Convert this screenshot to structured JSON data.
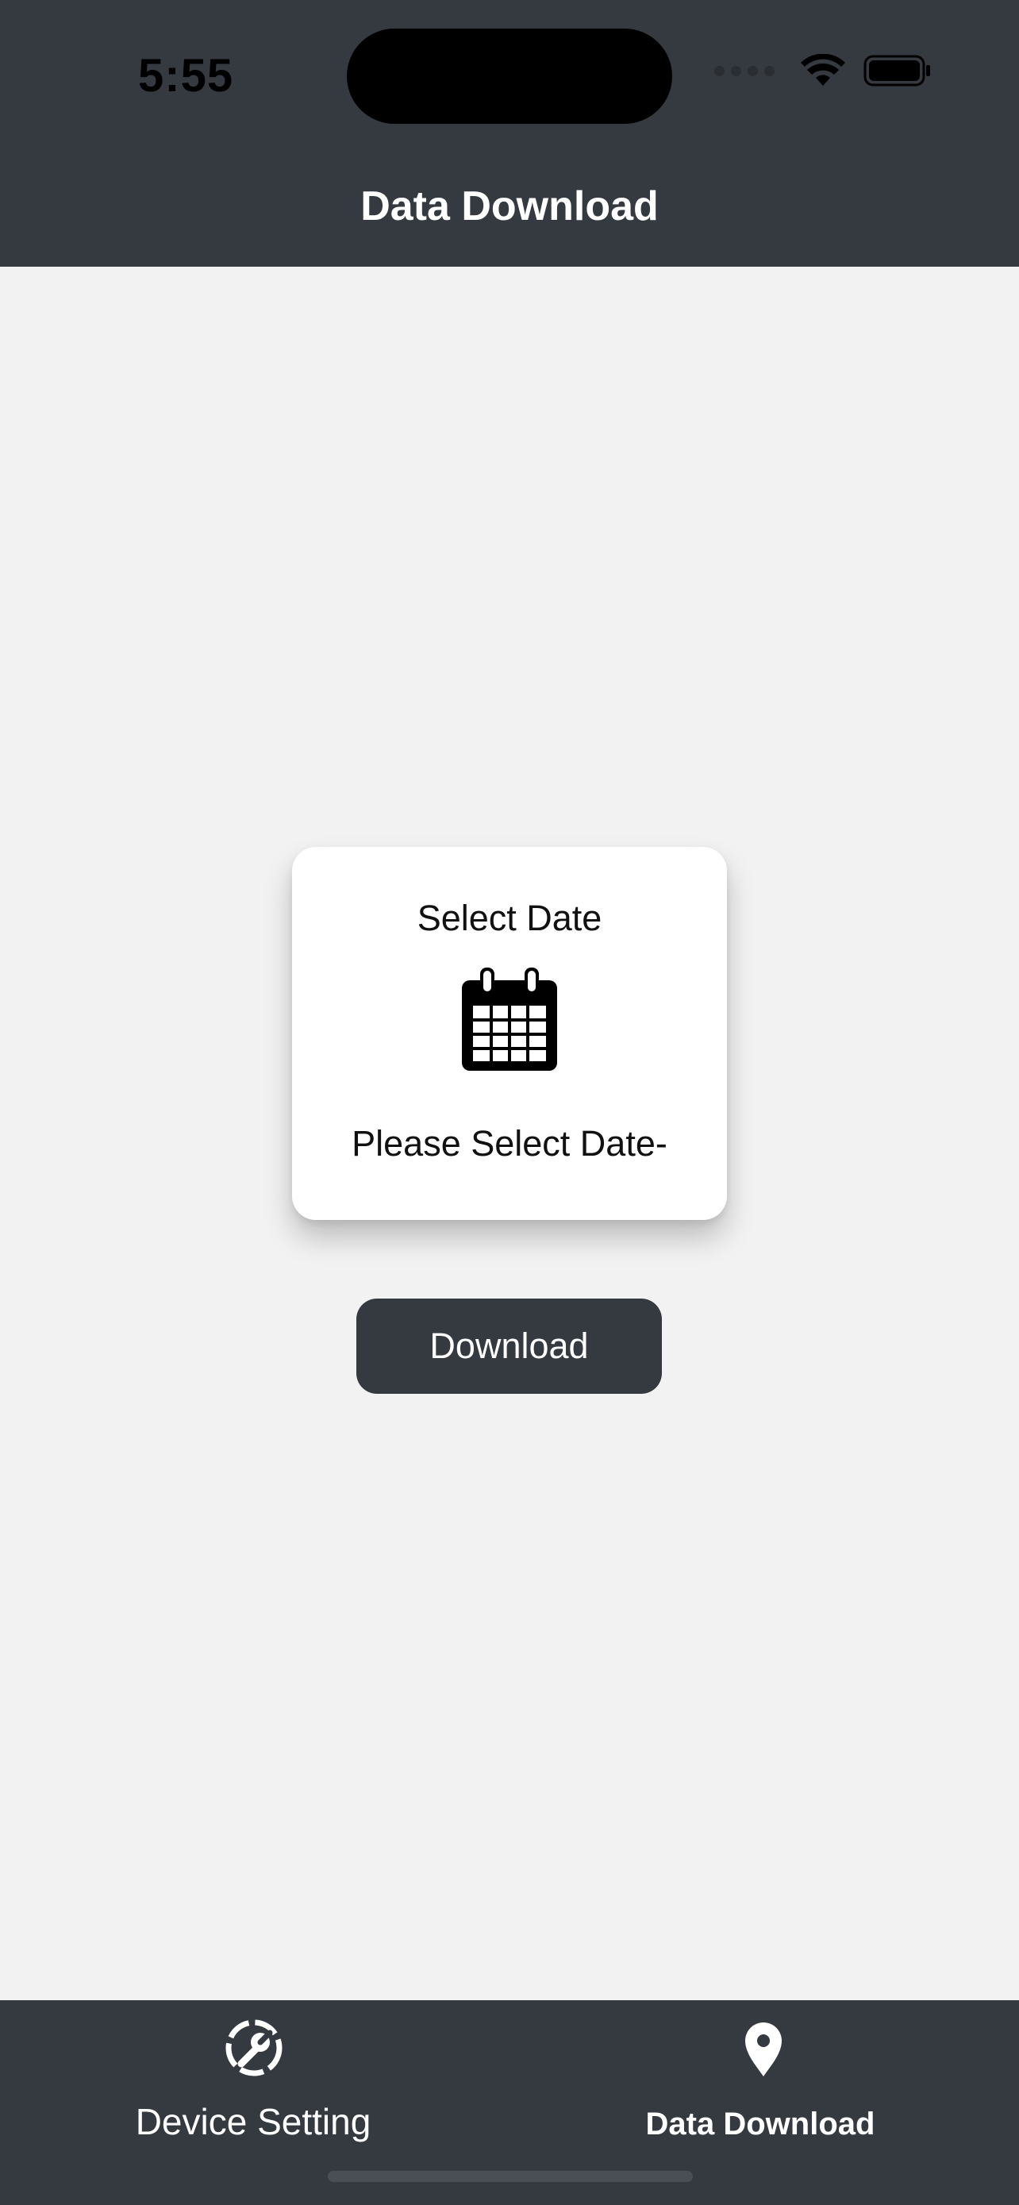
{
  "status_bar": {
    "time": "5:55"
  },
  "header": {
    "title": "Data Download"
  },
  "date_card": {
    "title": "Select Date",
    "icon": "calendar-icon",
    "value": "Please Select Date-"
  },
  "download_button": {
    "label": "Download"
  },
  "tab_bar": {
    "tabs": [
      {
        "label": "Device Setting",
        "icon": "wrench-gear-icon",
        "selected": false
      },
      {
        "label": "Data Download",
        "icon": "location-pin-icon",
        "selected": true
      }
    ]
  },
  "colors": {
    "header_bg": "#353940",
    "page_bg": "#f2f2f2",
    "card_bg": "#ffffff",
    "text_dark": "#111111",
    "text_light": "#ffffff"
  }
}
